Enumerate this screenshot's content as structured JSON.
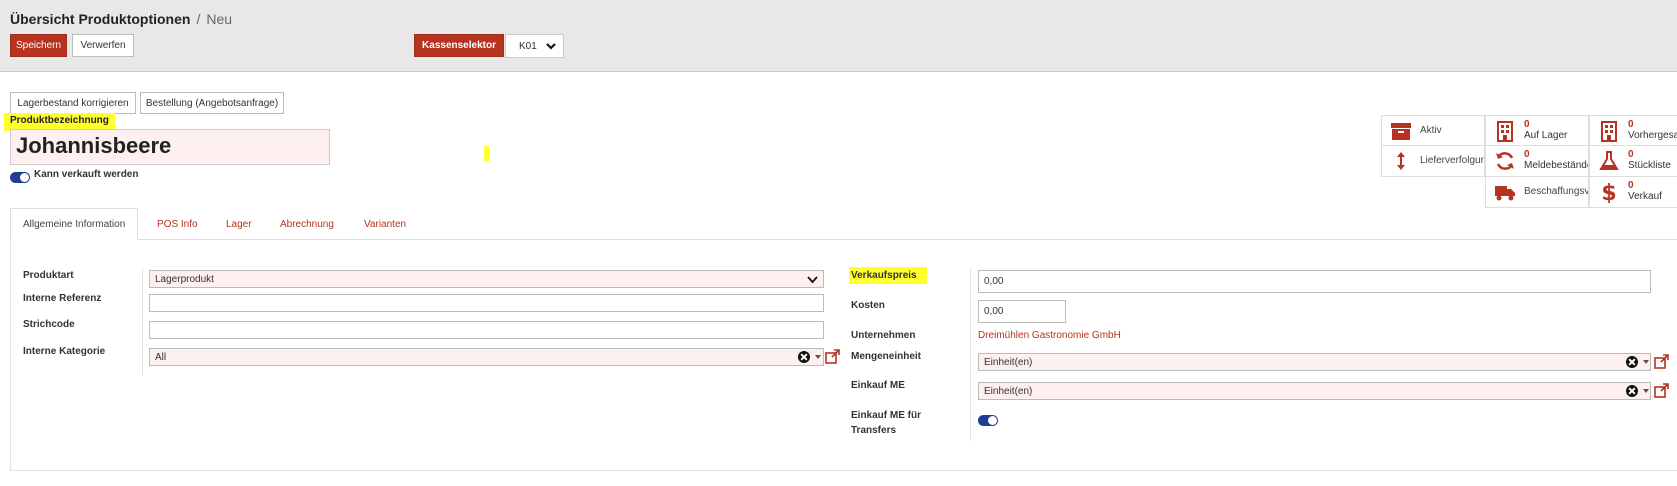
{
  "breadcrumb": {
    "parent": "Übersicht Produktoptionen",
    "separator": "/",
    "current": "Neu"
  },
  "toolbar": {
    "save_label": "Speichern",
    "discard_label": "Verwerfen",
    "cash_selector_label": "Kassenselektor",
    "cash_selector_value": "K01"
  },
  "header_buttons": {
    "adjust_stock": "Lagerbestand korrigieren",
    "order_request": "Bestellung (Angebotsanfrage)"
  },
  "product": {
    "name_label": "Produktbezeichnung",
    "name": "Johannisbeere",
    "can_be_sold_label": "Kann verkauft werden"
  },
  "smart_buttons": {
    "active": "Aktiv",
    "tracking": "Lieferverfolgung",
    "on_hand_count": "0",
    "on_hand": "Auf Lager",
    "reorder_count": "0",
    "reorder": "Meldebestände",
    "procurement": "Beschaffungsvo",
    "forecast_count": "0",
    "forecast": "Vorhergesa",
    "bom_count": "0",
    "bom": "Stückliste",
    "sales_count": "0",
    "sales": "Verkauf"
  },
  "tabs": [
    "Allgemeine Information",
    "POS Info",
    "Lager",
    "Abrechnung",
    "Varianten"
  ],
  "left_form": {
    "product_type_label": "Produktart",
    "product_type_value": "Lagerprodukt",
    "internal_ref_label": "Interne Referenz",
    "internal_ref_value": "",
    "barcode_label": "Strichcode",
    "barcode_value": "",
    "category_label": "Interne Kategorie",
    "category_value": "All"
  },
  "right_form": {
    "sales_price_label": "Verkaufspreis",
    "sales_price_value": "0,00",
    "cost_label": "Kosten",
    "cost_value": "0,00",
    "company_label": "Unternehmen",
    "company_value": "Dreimühlen Gastronomie GmbH",
    "uom_label": "Mengeneinheit",
    "uom_value": "Einheit(en)",
    "purchase_uom_label": "Einkauf ME",
    "purchase_uom_value": "Einheit(en)",
    "purchase_uom_transfers_label_1": "Einkauf ME für",
    "purchase_uom_transfers_label_2": "Transfers"
  },
  "colors": {
    "primary": "#b5331f",
    "highlight": "#ffff2e",
    "toggle": "#1e3f8f",
    "required_bg": "#fdf0ef"
  }
}
